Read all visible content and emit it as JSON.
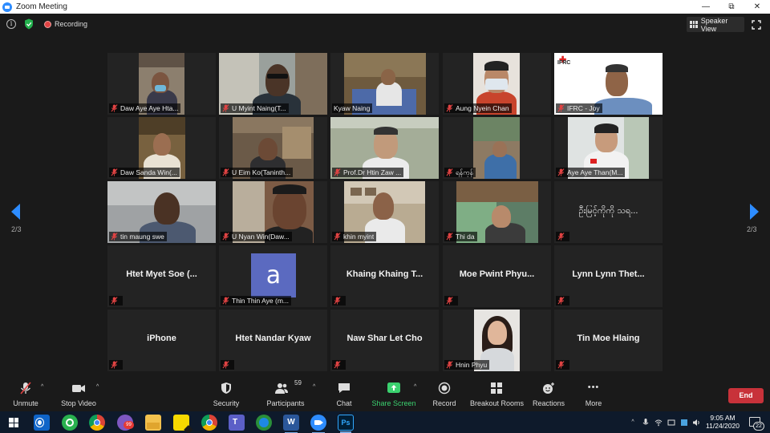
{
  "window": {
    "title": "Zoom Meeting",
    "restore_glyph": "⧉",
    "minimize_glyph": "—",
    "close_glyph": "✕"
  },
  "infobar": {
    "info_glyph": "i",
    "recording_label": "Recording",
    "speaker_view_label": "Speaker View"
  },
  "pagination": {
    "left_page": "2/3",
    "right_page": "2/3"
  },
  "participants": [
    {
      "name": "Daw Aye Aye Hta...",
      "muted": true
    },
    {
      "name": "U Myint Naing(T...",
      "muted": true
    },
    {
      "name": "Kyaw Naing",
      "muted": false
    },
    {
      "name": "Aung Nyein Chan",
      "muted": true
    },
    {
      "name": "IFRC - Joy",
      "muted": true
    },
    {
      "name": "Daw Sanda Win(...",
      "muted": true
    },
    {
      "name": "U Eim Ko(Taninth...",
      "muted": true
    },
    {
      "name": "Prof.Dr Htin Zaw ...",
      "muted": true
    },
    {
      "name": "ရန်ကုန်",
      "muted": true
    },
    {
      "name": "Aye Aye Than(M...",
      "muted": true
    },
    {
      "name": "tin maung swe",
      "muted": true
    },
    {
      "name": "U Nyan Win(Daw...",
      "muted": true
    },
    {
      "name": "khin myint",
      "muted": true
    },
    {
      "name": "Thi da",
      "muted": true
    },
    {
      "name": "ဦးမြင့်ကိုကို သရ...",
      "muted": true
    },
    {
      "name": "Htet Myet Soe (...",
      "muted": true
    },
    {
      "name": "Thin Thin Aye (m...",
      "muted": true
    },
    {
      "name": "Khaing Khaing T...",
      "muted": true
    },
    {
      "name": "Moe Pwint Phyu...",
      "muted": true
    },
    {
      "name": "Lynn Lynn Thet...",
      "muted": true
    },
    {
      "name": "iPhone",
      "muted": true
    },
    {
      "name": "Htet Nandar Kyaw",
      "muted": true
    },
    {
      "name": "Naw Shar Let Cho",
      "muted": true
    },
    {
      "name": "Hnin Phyu",
      "muted": true
    },
    {
      "name": "Tin Moe Hlaing",
      "muted": true
    }
  ],
  "tile_extras": {
    "ifrc_logo": "IFRC",
    "avatar_letter": "a"
  },
  "toolbar": {
    "unmute": "Unmute",
    "stop_video": "Stop Video",
    "security": "Security",
    "participants": "Participants",
    "participant_count": "59",
    "chat": "Chat",
    "share_screen": "Share Screen",
    "record": "Record",
    "breakout_rooms": "Breakout Rooms",
    "reactions": "Reactions",
    "more": "More",
    "more_glyph": "•••",
    "end": "End",
    "caret_glyph": "^"
  },
  "taskbar": {
    "time": "9:05 AM",
    "date": "11/24/2020",
    "notification_count": "22",
    "viber_badge": "99",
    "word_letter": "W",
    "ps_letter": "Ps"
  },
  "colors": {
    "accent_blue": "#2d8cff",
    "end_red": "#c8323a",
    "share_green": "#3bd16f",
    "mute_red": "#e04343"
  }
}
